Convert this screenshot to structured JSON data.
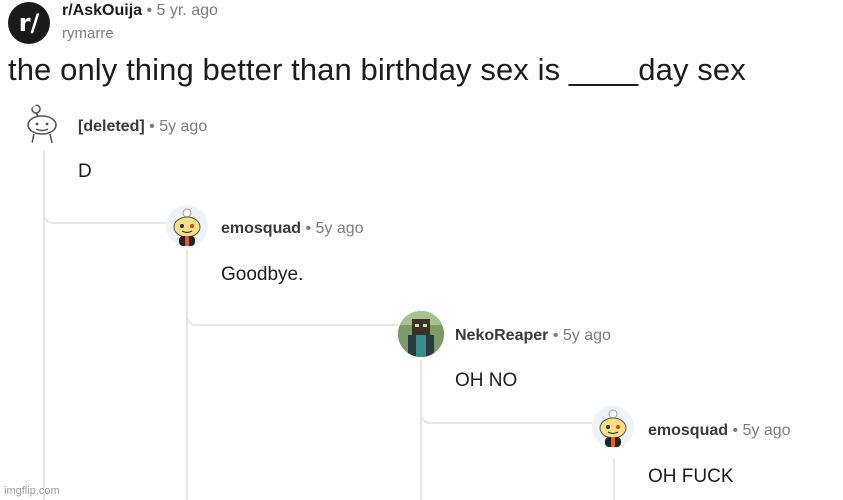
{
  "post": {
    "subreddit_icon_text": "r/",
    "subreddit": "r/AskOuija",
    "separator": "•",
    "time": "5 yr. ago",
    "author": "rymarre",
    "title": "the only thing better than birthday sex is ____day sex"
  },
  "comments": [
    {
      "username": "[deleted]",
      "separator": "•",
      "time": "5y ago",
      "text": "D",
      "avatar": "deleted-snoo"
    },
    {
      "username": "emosquad",
      "separator": "•",
      "time": "5y ago",
      "text": "Goodbye.",
      "avatar": "snoo"
    },
    {
      "username": "NekoReaper",
      "separator": "•",
      "time": "5y ago",
      "text": "OH NO",
      "avatar": "pixel-character"
    },
    {
      "username": "emosquad",
      "separator": "•",
      "time": "5y ago",
      "text": "OH FUCK",
      "avatar": "snoo"
    }
  ],
  "watermark": "imgflip.com",
  "colors": {
    "thread_line": "#e6e6e6",
    "meta_text": "#7c7c7c",
    "icon_bg": "#1a1a1b"
  }
}
